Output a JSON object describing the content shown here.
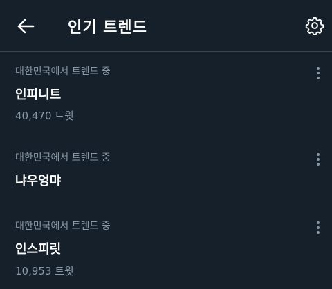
{
  "header": {
    "back_icon": "arrow-left-icon",
    "title": "인기 트렌드",
    "settings_icon": "gear-icon"
  },
  "trends": [
    {
      "context": "대한민국에서 트렌드 중",
      "name": "인피니트",
      "count": "40,470 트윗",
      "more_icon": "more-vertical-icon"
    },
    {
      "context": "대한민국에서 트렌드 중",
      "name": "냐우엉먀",
      "count": "",
      "more_icon": "more-vertical-icon"
    },
    {
      "context": "대한민국에서 트렌드 중",
      "name": "인스피릿",
      "count": "10,953 트윗",
      "more_icon": "more-vertical-icon"
    }
  ],
  "colors": {
    "background": "#15202b",
    "divider": "#38444d",
    "primary_text": "#ffffff",
    "secondary_text": "#8899a6"
  }
}
